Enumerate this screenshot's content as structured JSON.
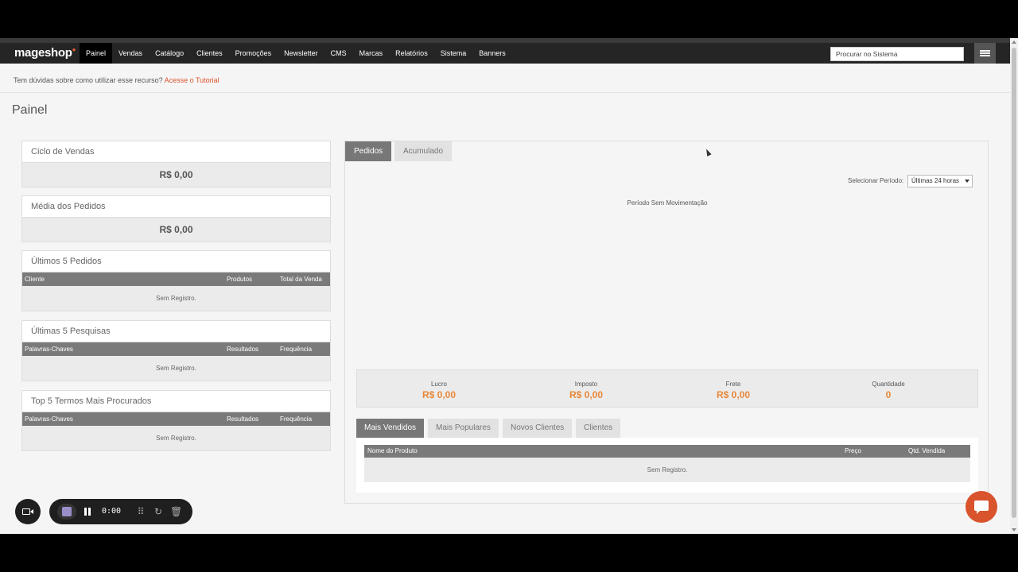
{
  "nav": {
    "logo": "mageshop",
    "items": [
      {
        "label": "Painel",
        "active": true
      },
      {
        "label": "Vendas"
      },
      {
        "label": "Catálogo"
      },
      {
        "label": "Clientes"
      },
      {
        "label": "Promoções"
      },
      {
        "label": "Newsletter"
      },
      {
        "label": "CMS"
      },
      {
        "label": "Marcas"
      },
      {
        "label": "Relatórios"
      },
      {
        "label": "Sistema"
      },
      {
        "label": "Banners"
      }
    ],
    "search_placeholder": "Procurar no Sistema",
    "menu_icon": "hamburger-icon"
  },
  "tutorial": {
    "text": "Tem dúvidas sobre como utilizar esse recurso?",
    "link": "Acesse o Tutorial"
  },
  "page_title": "Painel",
  "left": {
    "ciclo": {
      "title": "Ciclo de Vendas",
      "value": "R$ 0,00"
    },
    "media": {
      "title": "Média dos Pedidos",
      "value": "R$ 0,00"
    },
    "pedidos": {
      "title": "Últimos 5 Pedidos",
      "cols": [
        "Cliente",
        "Produtos",
        "Total da Venda"
      ],
      "empty": "Sem Registro."
    },
    "pesquisas": {
      "title": "Últimas 5 Pesquisas",
      "cols": [
        "Palavras-Chaves",
        "Resultados",
        "Frequência"
      ],
      "empty": "Sem Registro."
    },
    "termos": {
      "title": "Top 5 Termos Mais Procurados",
      "cols": [
        "Palavras-Chaves",
        "Resultados",
        "Frequência"
      ],
      "empty": "Sem Registro."
    }
  },
  "right": {
    "tabs": [
      "Pedidos",
      "Acumulado"
    ],
    "period_label": "Selecionar Período:",
    "period_value": "Últimas 24 horas",
    "no_movement": "Período Sem Movimentação",
    "totals": [
      {
        "label": "Lucro",
        "value": "R$ 0,00"
      },
      {
        "label": "Imposto",
        "value": "R$ 0,00"
      },
      {
        "label": "Frete",
        "value": "R$ 0,00"
      },
      {
        "label": "Quantidade",
        "value": "0"
      }
    ],
    "tabs2": [
      "Mais Vendidos",
      "Mais Populares",
      "Novos Clientes",
      "Clientes"
    ],
    "product_cols": [
      "Nome do Produto",
      "Preço",
      "Qtd. Vendida"
    ],
    "empty": "Sem Registro."
  },
  "recorder": {
    "time": "0:00"
  },
  "colors": {
    "accent": "#d9532c",
    "totals": "#e8883a",
    "nav": "#252525"
  }
}
